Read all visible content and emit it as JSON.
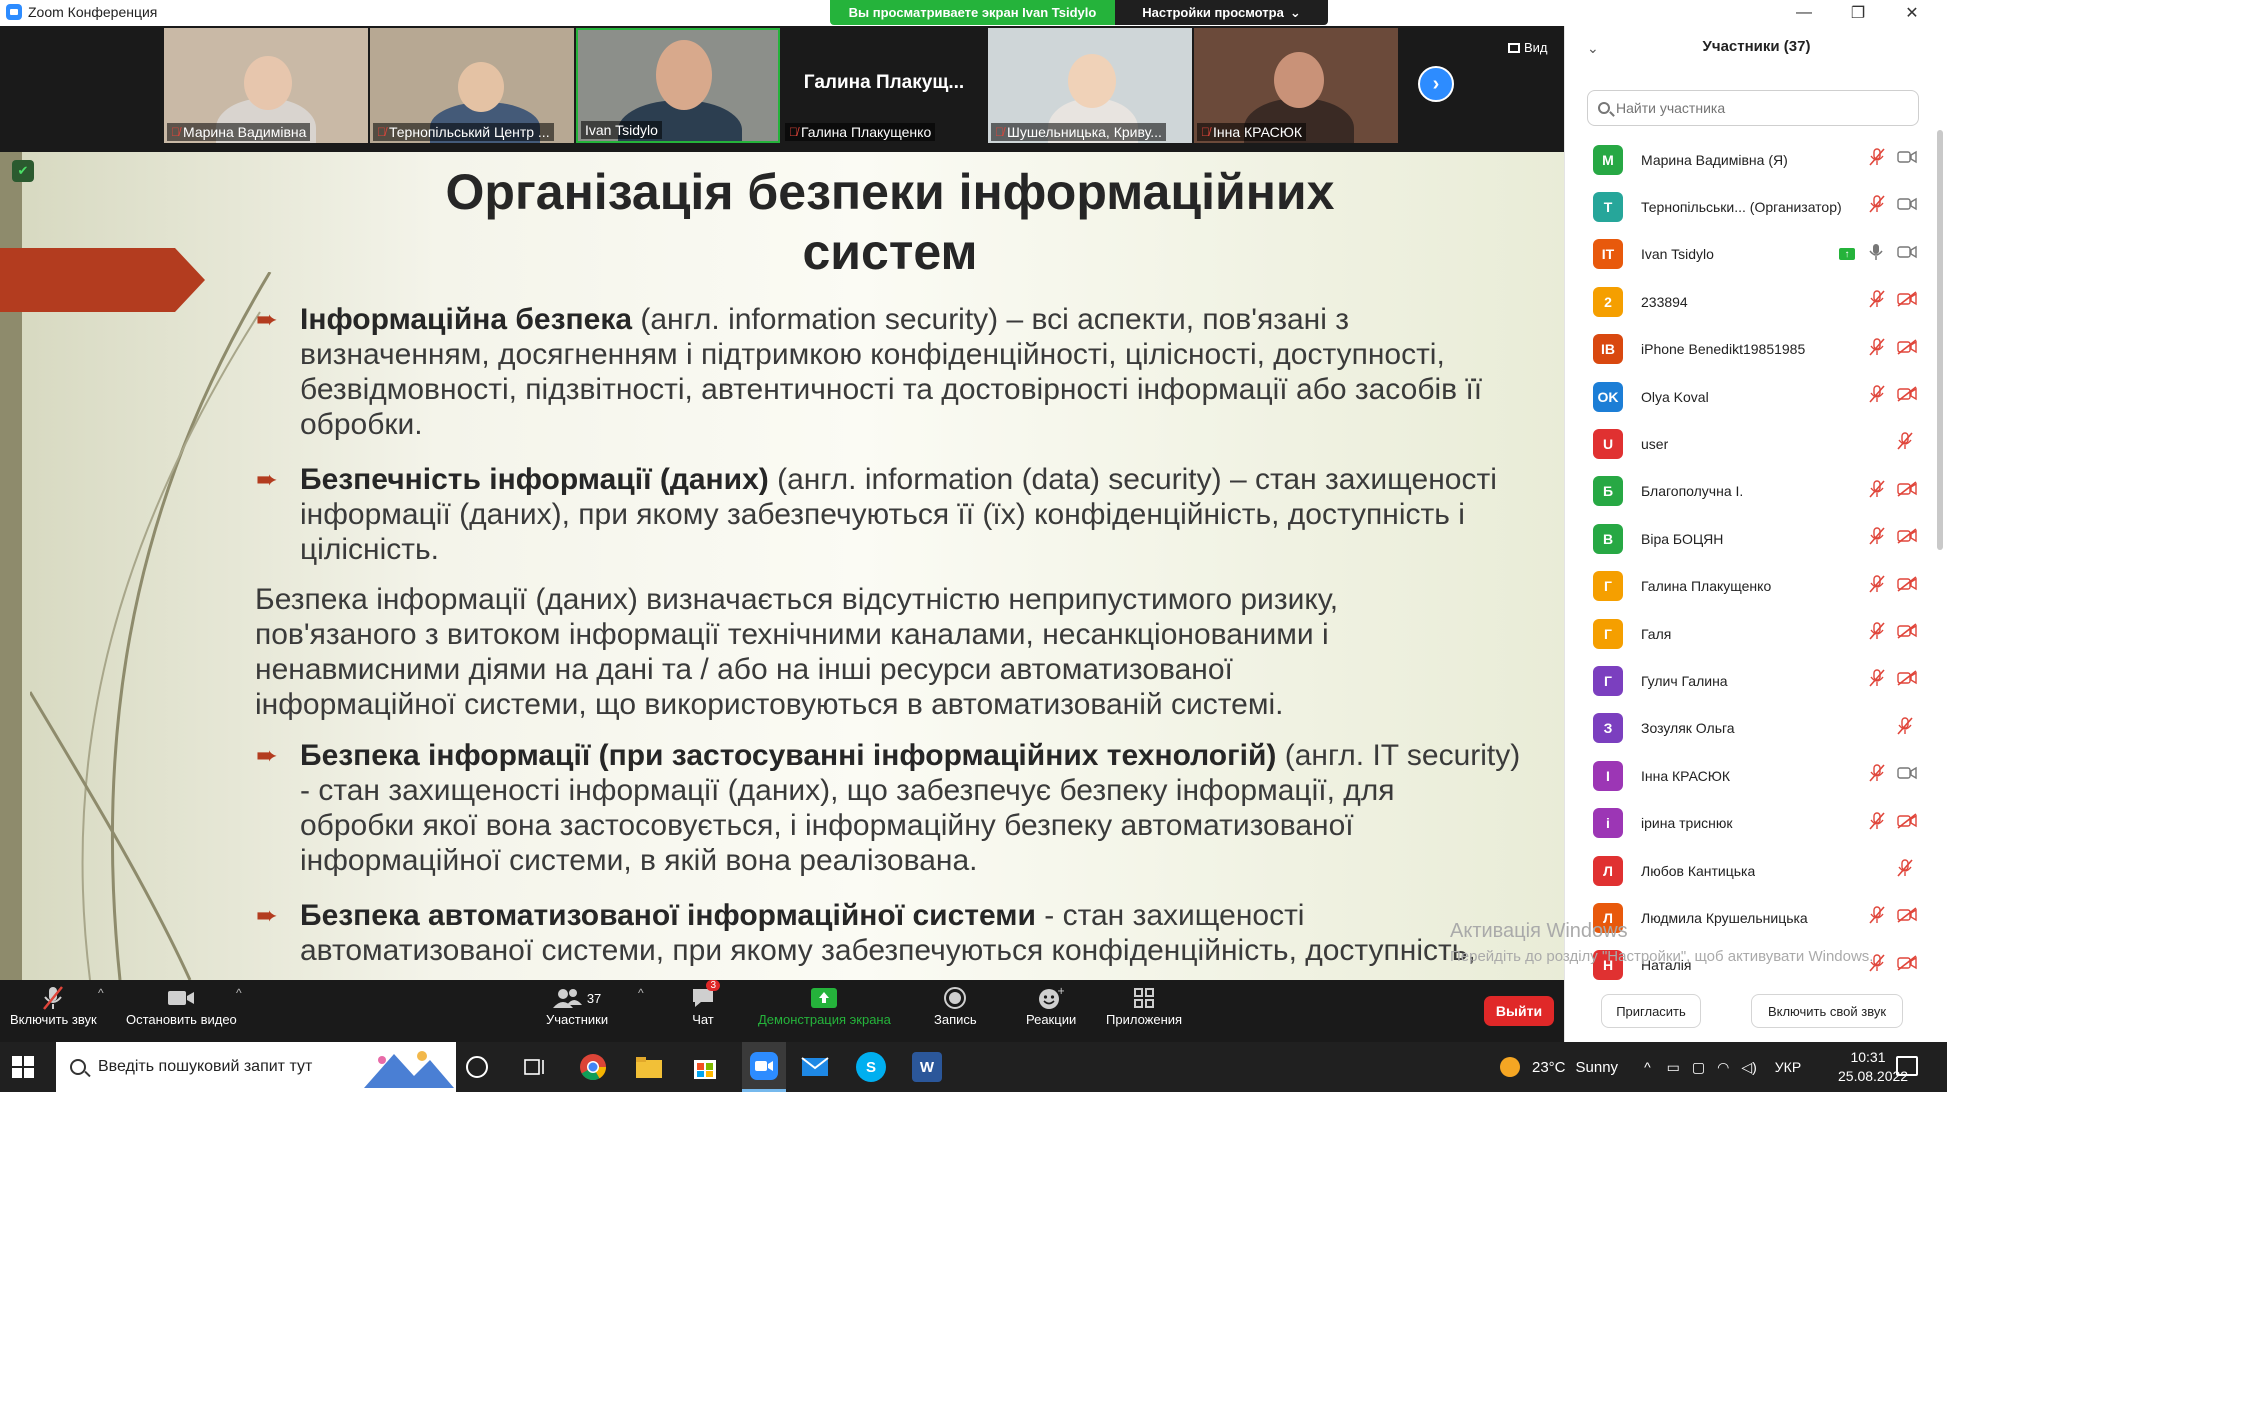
{
  "window": {
    "app_title": "Zoom Конференция",
    "viewing_badge": "Вы просматриваете экран Ivan Tsidylo",
    "view_options": "Настройки просмотра",
    "controls": {
      "minimize": "—",
      "maximize": "❐",
      "close": "✕"
    }
  },
  "video_strip": {
    "tiles": [
      {
        "name": "Марина Вадимівна"
      },
      {
        "name": "Тернопільський Центр ..."
      },
      {
        "name": "Ivan Tsidylo"
      },
      {
        "name": "Галина Плакущенко",
        "big_label": "Галина  Плакущ..."
      },
      {
        "name": "Шушельницька, Криву..."
      },
      {
        "name": "Інна КРАСЮК"
      }
    ],
    "next_icon": "›",
    "view_label": "Вид"
  },
  "slide": {
    "title_line1": "Організація безпеки інформаційних",
    "title_line2": "систем",
    "p1_bold": "Інформаційна безпека",
    "p1_rest_l1": " (англ. information security)  – всі аспекти, пов'язані з",
    "p1_l2": "визначенням, досягненням і підтримкою конфіденційності, цілісності, доступності,",
    "p1_l3": "безвідмовності, підзвітності, автентичності та достовірності інформації або засобів її",
    "p1_l4": "обробки.",
    "p2_bold": "Безпечність інформації (даних)",
    "p2_rest_l1": " (англ. information (data) security) – стан захищеності",
    "p2_l2": "інформації (даних), при якому забезпечуються її (їх) конфіденційність, доступність і",
    "p2_l3": "цілісність.",
    "p3_l1": "Безпека інформації (даних) визначається відсутністю неприпустимого ризику,",
    "p3_l2": "пов'язаного з витоком інформації технічними каналами, несанкціонованими і",
    "p3_l3": "ненавмисними діями на дані та / або на інші ресурси автоматизованої",
    "p3_l4": "інформаційної системи, що використовуються в автоматизованій системі.",
    "p4_bold": "Безпека інформації (при застосуванні інформаційних технологій)",
    "p4_rest_l1": " (англ. IT security)",
    "p4_l2": "- стан захищеності інформації (даних), що забезпечує безпеку інформації, для",
    "p4_l3": "обробки якої вона застосовується, і інформаційну безпеку автоматизованої",
    "p4_l4": "інформаційної системи, в якій вона реалізована.",
    "p5_bold": "Безпека автоматизованої інформаційної системи",
    "p5_rest_l1": " - стан захищеності",
    "p5_l2": "автоматизованої системи, при якому забезпечуються конфіденційність, доступність,",
    "activation_title": "Активація Windows",
    "activation_sub": "Перейдіть до розділу \"Настройки\", щоб активувати Windows."
  },
  "toolbar": {
    "mute_label": "Включить звук",
    "video_label": "Остановить видео",
    "participants_label": "Участники",
    "participants_count": "37",
    "chat_label": "Чат",
    "chat_badge": "3",
    "share_label": "Демонстрация экрана",
    "record_label": "Запись",
    "reactions_label": "Реакции",
    "apps_label": "Приложения",
    "leave_label": "Выйти"
  },
  "panel": {
    "title": "Участники (37)",
    "search_placeholder": "Найти участника",
    "invite_label": "Пригласить",
    "unmute_self_label": "Включить свой звук",
    "participants": [
      {
        "initial": "М",
        "name": "Марина Вадимівна (Я)",
        "color": "#27a844",
        "mic": "off",
        "cam": "on"
      },
      {
        "initial": "Т",
        "name": "Тернопільськи... (Организатор)",
        "color": "#26a69a",
        "mic": "off",
        "cam": "on"
      },
      {
        "initial": "IT",
        "name": "Ivan Tsidylo",
        "color": "#e8590c",
        "mic": "live",
        "cam": "on",
        "sharing": true
      },
      {
        "initial": "2",
        "name": "233894",
        "color": "#f59f00",
        "mic": "off",
        "cam": "off"
      },
      {
        "initial": "IB",
        "name": "iPhone Benedikt19851985",
        "color": "#d9480f",
        "mic": "off",
        "cam": "off"
      },
      {
        "initial": "OK",
        "name": "Olya Koval",
        "color": "#1c7ed6",
        "mic": "off",
        "cam": "off"
      },
      {
        "initial": "U",
        "name": "user",
        "color": "#e03131",
        "mic": "off",
        "cam": "none"
      },
      {
        "initial": "Б",
        "name": "Благополучна І.",
        "color": "#27a844",
        "mic": "off",
        "cam": "off"
      },
      {
        "initial": "В",
        "name": "Віра БОЦЯН",
        "color": "#27a844",
        "mic": "off",
        "cam": "off"
      },
      {
        "initial": "Г",
        "name": "Галина Плакущенко",
        "color": "#f59f00",
        "mic": "off",
        "cam": "off"
      },
      {
        "initial": "Г",
        "name": "Галя",
        "color": "#f59f00",
        "mic": "off",
        "cam": "off"
      },
      {
        "initial": "Г",
        "name": "Гулич Галина",
        "color": "#7b3fbf",
        "mic": "off",
        "cam": "off"
      },
      {
        "initial": "З",
        "name": "Зозуляк Ольга",
        "color": "#7b3fbf",
        "mic": "off",
        "cam": "none"
      },
      {
        "initial": "І",
        "name": "Інна КРАСЮК",
        "color": "#9c36b5",
        "mic": "off",
        "cam": "on"
      },
      {
        "initial": "і",
        "name": "ірина триснюк",
        "color": "#9c36b5",
        "mic": "off",
        "cam": "off"
      },
      {
        "initial": "Л",
        "name": "Любов Кантицька",
        "color": "#e03131",
        "mic": "off",
        "cam": "none"
      },
      {
        "initial": "Л",
        "name": "Людмила Крушельницька",
        "color": "#e8590c",
        "mic": "off",
        "cam": "off"
      },
      {
        "initial": "Н",
        "name": "Наталія",
        "color": "#e03131",
        "mic": "off",
        "cam": "off"
      }
    ]
  },
  "taskbar": {
    "search_placeholder": "Введіть пошуковий запит тут",
    "weather_temp": "23°C",
    "weather_text": "Sunny",
    "language": "УКР",
    "time": "10:31",
    "date": "25.08.2022"
  }
}
